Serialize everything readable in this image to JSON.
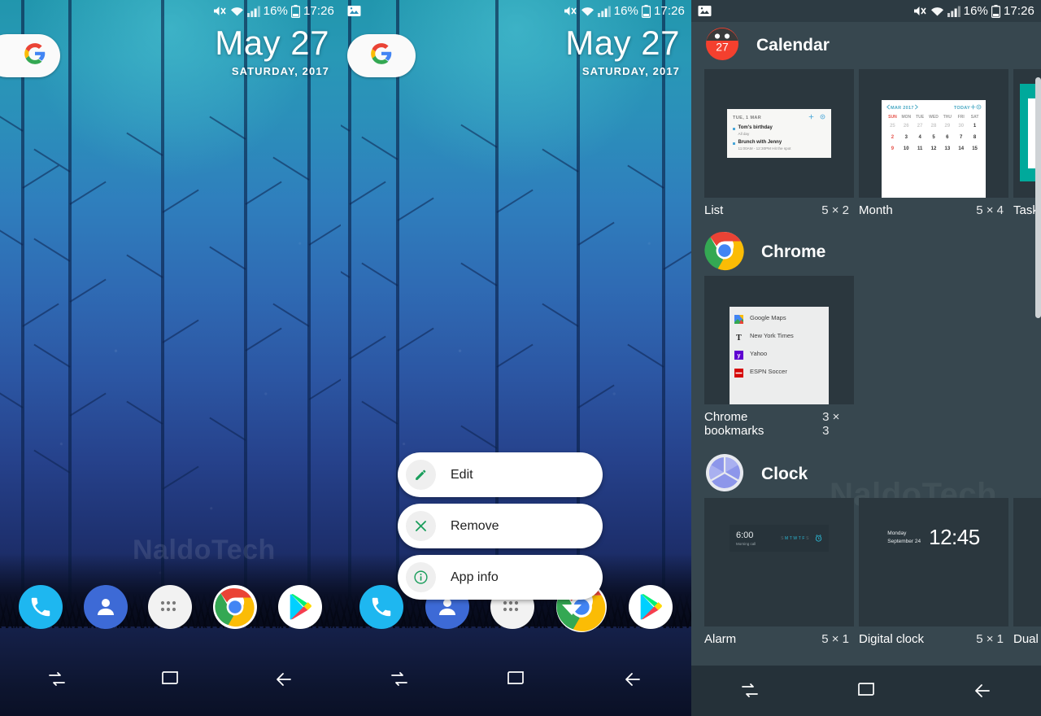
{
  "status_bar": {
    "mute_icon": "mute-icon",
    "wifi_icon": "wifi-icon",
    "signal_icon": "signal-icon",
    "battery_percent": "16%",
    "battery_icon": "battery-icon",
    "time": "17:26",
    "screenshot_icon": "screenshot-icon"
  },
  "home": {
    "google_logo": "google-g-logo",
    "date": "May 27",
    "weekday_year": "SATURDAY, 2017",
    "watermark": "NaldoTech",
    "dock": [
      {
        "name": "phone",
        "label": "Phone"
      },
      {
        "name": "contacts",
        "label": "Contacts"
      },
      {
        "name": "app-drawer",
        "label": "Apps"
      },
      {
        "name": "chrome",
        "label": "Chrome"
      },
      {
        "name": "play-store",
        "label": "Play Store"
      }
    ]
  },
  "nav_bar": {
    "recents": "recents-icon",
    "home": "home-icon",
    "back": "back-icon"
  },
  "popup_menu": {
    "items": [
      {
        "label": "Edit",
        "icon": "pencil-icon",
        "color": "#1a9e5c"
      },
      {
        "label": "Remove",
        "icon": "close-x-icon",
        "color": "#1a9e5c"
      },
      {
        "label": "App info",
        "icon": "info-circle-icon",
        "color": "#1a9e5c"
      }
    ]
  },
  "widget_picker": {
    "accent": "#37474f",
    "groups": [
      {
        "app": "Calendar",
        "icon": "calendar-app-icon",
        "icon_badge": "27",
        "widgets": [
          {
            "label": "List",
            "size": "5 × 2",
            "preview": {
              "header_date": "TUE, 1 MAR",
              "events": [
                {
                  "title": "Tom's birthday",
                  "sub": "All day"
                },
                {
                  "title": "Brunch with Jenny",
                  "sub": "11:00AM - 12:30PM   Hit the spot"
                }
              ],
              "add_icon": "plus-icon",
              "settings_icon": "gear-icon"
            }
          },
          {
            "label": "Month",
            "size": "5 × 4",
            "preview": {
              "month_title": "MAR 2017",
              "today_label": "TODAY",
              "prev_icon": "chevron-left-icon",
              "next_icon": "chevron-right-icon",
              "add_icon": "plus-icon",
              "settings_icon": "gear-icon",
              "weekday_headers": [
                "SUN",
                "MON",
                "TUE",
                "WED",
                "THU",
                "FRI",
                "SAT"
              ],
              "week_rows": [
                [
                  "25",
                  "26",
                  "27",
                  "28",
                  "29",
                  "30",
                  "1"
                ],
                [
                  "2",
                  "3",
                  "4",
                  "5",
                  "6",
                  "7",
                  "8"
                ],
                [
                  "9",
                  "10",
                  "11",
                  "12",
                  "13",
                  "14",
                  "15"
                ]
              ]
            }
          },
          {
            "label": "Tasks",
            "size": ""
          }
        ]
      },
      {
        "app": "Chrome",
        "icon": "chrome-app-icon",
        "widgets": [
          {
            "label": "Chrome bookmarks",
            "size": "3 × 3",
            "preview": {
              "bookmarks": [
                {
                  "title": "Google Maps",
                  "icon": "maps-icon"
                },
                {
                  "title": "New York Times",
                  "icon": "nyt-icon"
                },
                {
                  "title": "Yahoo",
                  "icon": "yahoo-icon"
                },
                {
                  "title": "ESPN Soccer",
                  "icon": "espn-icon"
                }
              ]
            }
          }
        ]
      },
      {
        "app": "Clock",
        "icon": "clock-app-icon",
        "widgets": [
          {
            "label": "Alarm",
            "size": "5 × 1",
            "preview": {
              "time": "6:00",
              "name": "Morning call",
              "weekdays": [
                "S",
                "M",
                "T",
                "W",
                "T",
                "F",
                "S"
              ],
              "weekdays_active": [
                false,
                true,
                true,
                true,
                true,
                true,
                false
              ],
              "alarm_icon": "alarm-clock-icon"
            }
          },
          {
            "label": "Digital clock",
            "size": "5 × 1",
            "preview": {
              "weekday": "Monday",
              "date": "September 24",
              "time": "12:45"
            }
          },
          {
            "label": "Dual",
            "size": ""
          }
        ]
      }
    ],
    "watermark": "NaldoTech"
  }
}
